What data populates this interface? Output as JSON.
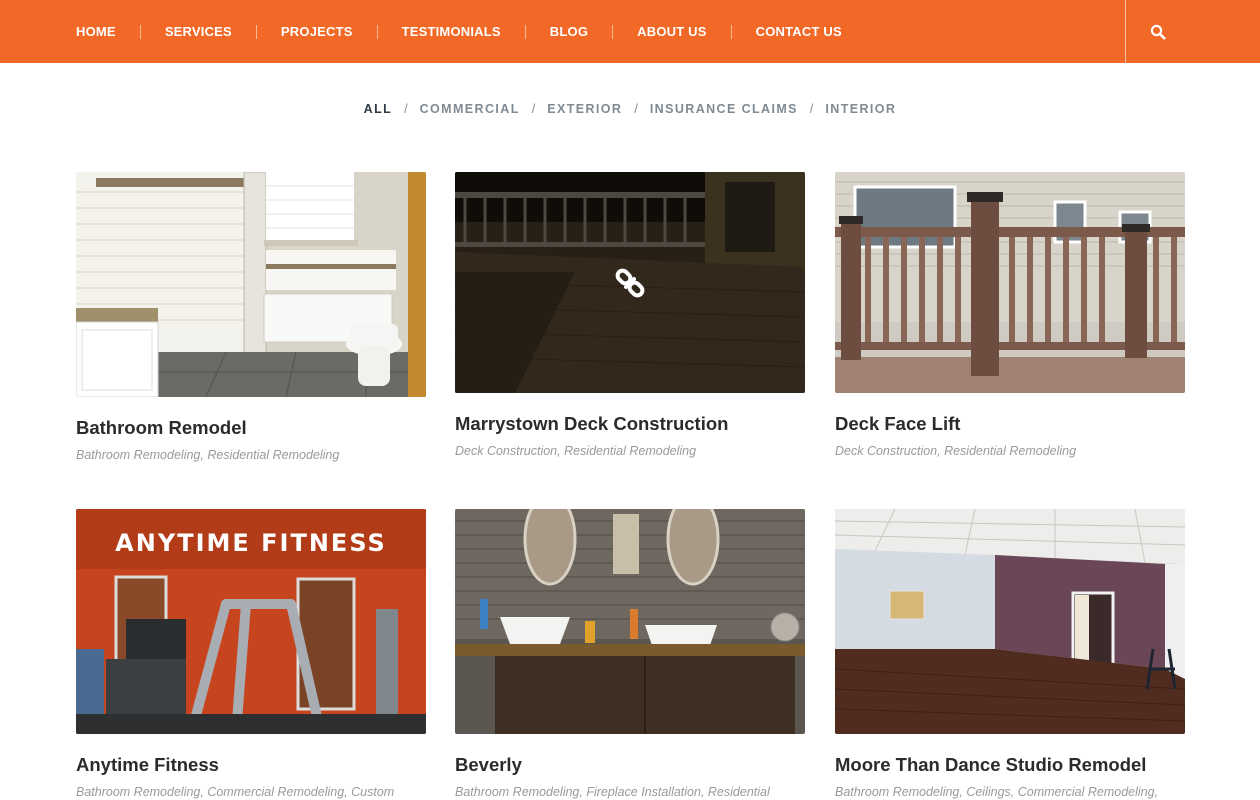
{
  "nav": {
    "items": [
      {
        "label": "HOME"
      },
      {
        "label": "SERVICES"
      },
      {
        "label": "PROJECTS"
      },
      {
        "label": "TESTIMONIALS"
      },
      {
        "label": "BLOG"
      },
      {
        "label": "ABOUT US"
      },
      {
        "label": "CONTACT US"
      }
    ],
    "search_icon": "search-icon",
    "accent": "#f26826"
  },
  "filters": {
    "items": [
      {
        "label": "ALL",
        "active": true
      },
      {
        "label": "COMMERCIAL",
        "active": false
      },
      {
        "label": "EXTERIOR",
        "active": false
      },
      {
        "label": "INSURANCE CLAIMS",
        "active": false
      },
      {
        "label": "INTERIOR",
        "active": false
      }
    ],
    "separator": "/"
  },
  "projects": [
    {
      "title": "Bathroom Remodel",
      "categories": "Bathroom Remodeling, Residential Remodeling"
    },
    {
      "title": "Marrystown Deck Construction",
      "categories": "Deck Construction, Residential Remodeling",
      "hover_icon": "link-icon"
    },
    {
      "title": "Deck Face Lift",
      "categories": "Deck Construction, Residential Remodeling"
    },
    {
      "title": "Anytime Fitness",
      "categories": "Bathroom Remodeling, Commercial Remodeling, Custom",
      "image_text": "ANYTIME FITNESS"
    },
    {
      "title": "Beverly",
      "categories": "Bathroom Remodeling, Fireplace Installation, Residential"
    },
    {
      "title": "Moore Than Dance Studio Remodel",
      "categories": "Bathroom Remodeling, Ceilings, Commercial Remodeling,"
    }
  ]
}
